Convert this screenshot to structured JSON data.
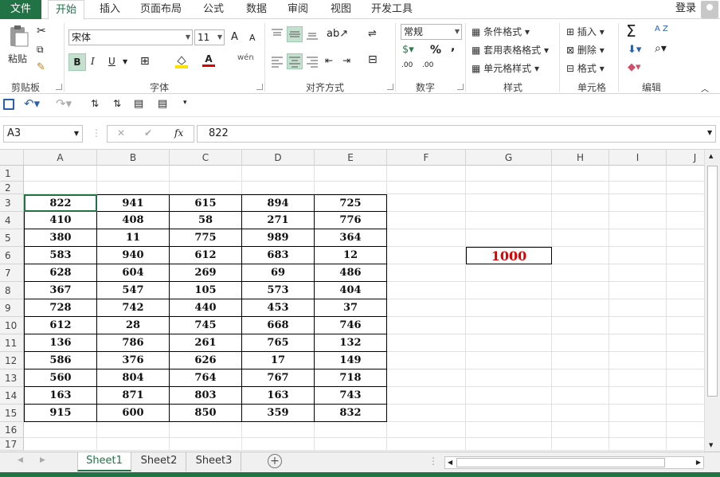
{
  "menubar": {
    "file": "文件",
    "tabs": [
      "开始",
      "插入",
      "页面布局",
      "公式",
      "数据",
      "审阅",
      "视图",
      "开发工具"
    ],
    "login": "登录"
  },
  "ribbon": {
    "clipboard": {
      "paste": "粘贴",
      "label": "剪贴板"
    },
    "font": {
      "name": "宋体",
      "size": "11",
      "bold": "B",
      "italic": "I",
      "underline": "U",
      "label": "字体",
      "grow": "A",
      "shrink": "A",
      "wen": "wén"
    },
    "align": {
      "label": "对齐方式"
    },
    "number": {
      "format": "常规",
      "percent": "%",
      "comma": ",",
      "label": "数字",
      "inc": ".00",
      "dec": ".00"
    },
    "styles": {
      "cond": "条件格式",
      "table": "套用表格格式",
      "cell": "单元格样式",
      "label": "样式"
    },
    "cells": {
      "insert": "插入",
      "delete": "删除",
      "format": "格式",
      "label": "单元格"
    },
    "edit": {
      "sum": "Σ",
      "sort": "A Z",
      "label": "编辑"
    }
  },
  "formula": {
    "namebox": "A3",
    "value": "822",
    "fx": "fx",
    "cancel": "✕",
    "confirm": "✔"
  },
  "columns": [
    "A",
    "B",
    "C",
    "D",
    "E",
    "F",
    "G",
    "H",
    "I",
    "J"
  ],
  "rows": [
    "1",
    "2",
    "3",
    "4",
    "5",
    "6",
    "7",
    "8",
    "9",
    "10",
    "11",
    "12",
    "13",
    "14",
    "15",
    "16",
    "17"
  ],
  "table": [
    [
      "822",
      "941",
      "615",
      "894",
      "725"
    ],
    [
      "410",
      "408",
      "58",
      "271",
      "776"
    ],
    [
      "380",
      "11",
      "775",
      "989",
      "364"
    ],
    [
      "583",
      "940",
      "612",
      "683",
      "12"
    ],
    [
      "628",
      "604",
      "269",
      "69",
      "486"
    ],
    [
      "367",
      "547",
      "105",
      "573",
      "404"
    ],
    [
      "728",
      "742",
      "440",
      "453",
      "37"
    ],
    [
      "612",
      "28",
      "745",
      "668",
      "746"
    ],
    [
      "136",
      "786",
      "261",
      "765",
      "132"
    ],
    [
      "586",
      "376",
      "626",
      "17",
      "149"
    ],
    [
      "560",
      "804",
      "764",
      "767",
      "718"
    ],
    [
      "163",
      "871",
      "803",
      "163",
      "743"
    ],
    [
      "915",
      "600",
      "850",
      "359",
      "832"
    ]
  ],
  "g6": "1000",
  "sheets": [
    "Sheet1",
    "Sheet2",
    "Sheet3"
  ],
  "colors": {
    "accent": "#217346",
    "highlight": "#e00000"
  }
}
